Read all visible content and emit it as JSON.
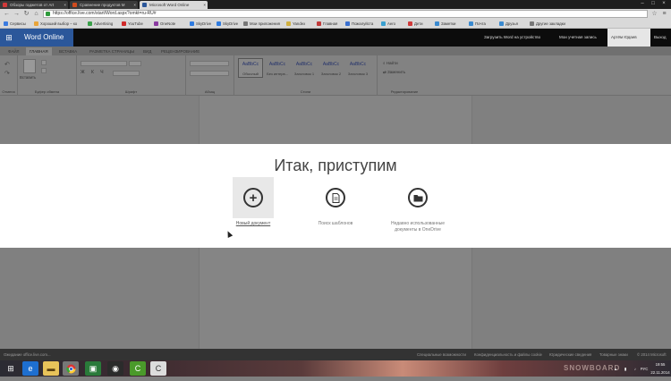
{
  "browser": {
    "tabs": [
      {
        "label": "Обзоры гаджетов от Art",
        "color": "#d13a3a"
      },
      {
        "label": "Сравнение продуктов M",
        "color": "#cf4b1e"
      },
      {
        "label": "Microsoft Word Online",
        "color": "#2b579a"
      }
    ],
    "url": "https://office.live.com/start/Word.aspx?omkt=ru-RU#",
    "bookmarks": [
      {
        "label": "Сервисы",
        "color": "#3b7be0"
      },
      {
        "label": "Хороший выбор – ко",
        "color": "#e8a43a"
      },
      {
        "label": "Advertising",
        "color": "#3aa04a"
      },
      {
        "label": "YouTube",
        "color": "#d02a2a"
      },
      {
        "label": "OneNote",
        "color": "#8a3aa0"
      },
      {
        "label": "SkyDrive",
        "color": "#2f7be0"
      },
      {
        "label": "SkyDrive",
        "color": "#2f7be0"
      },
      {
        "label": "Мои приложения",
        "color": "#777"
      },
      {
        "label": "Yandex",
        "color": "#d0b040"
      },
      {
        "label": "Главная",
        "color": "#c03a3a"
      },
      {
        "label": "Пожалуйста",
        "color": "#3a70d0"
      },
      {
        "label": "Aero",
        "color": "#3aa0d0"
      },
      {
        "label": "Дети",
        "color": "#d03a3a"
      },
      {
        "label": "Заметки",
        "color": "#3a8ad0"
      },
      {
        "label": "Почта",
        "color": "#3a8ad0"
      },
      {
        "label": "Друзья",
        "color": "#3a8ad0"
      },
      {
        "label": "Другие закладки",
        "color": "#777"
      }
    ]
  },
  "word_header": {
    "app_name": "Word Online",
    "links": [
      "Загрузить Word на устройство",
      "Мои учетная запись",
      "Артём Юдаев",
      "Выход"
    ]
  },
  "ribbon": {
    "tabs": [
      "ФАЙЛ",
      "ГЛАВНАЯ",
      "ВСТАВКА",
      "РАЗМЕТКА СТРАНИЦЫ",
      "ВИД",
      "РЕЦЕНЗИРОВАНИЕ"
    ],
    "groups": [
      "Отмена",
      "Буфер обмена",
      "Шрифт",
      "Абзац",
      "Стили",
      "Редактирование"
    ],
    "paste_label": "Вставить",
    "styles": [
      {
        "sample": "AaBbCc",
        "name": "Обычный"
      },
      {
        "sample": "AaBbCc",
        "name": "Без интерв..."
      },
      {
        "sample": "AaBbCc",
        "name": "Заголовок 1"
      },
      {
        "sample": "AaBbCc",
        "name": "Заголовок 2"
      },
      {
        "sample": "AaBbCc",
        "name": "Заголовок 3"
      }
    ],
    "edit_items": [
      "Найти",
      "Заменить"
    ]
  },
  "start_dialog": {
    "title": "Итак, приступим",
    "options": [
      {
        "label": "Новый документ",
        "icon": "plus-icon"
      },
      {
        "label": "Поиск шаблонов",
        "icon": "document-icon"
      },
      {
        "label": "Недавно использованные документы в OneDrive",
        "icon": "folder-icon"
      }
    ]
  },
  "footer": {
    "status": "Ожидание office.live.com...",
    "links": [
      "Специальные возможности",
      "Конфиденциальность и файлы cookie",
      "Юридические сведения",
      "Товарные знаки",
      "© 2014 Microsoft"
    ]
  },
  "taskbar": {
    "time": "19:55",
    "date": "22.11.2014",
    "lang": "РУС",
    "watermark": "SNOWBOARD"
  }
}
